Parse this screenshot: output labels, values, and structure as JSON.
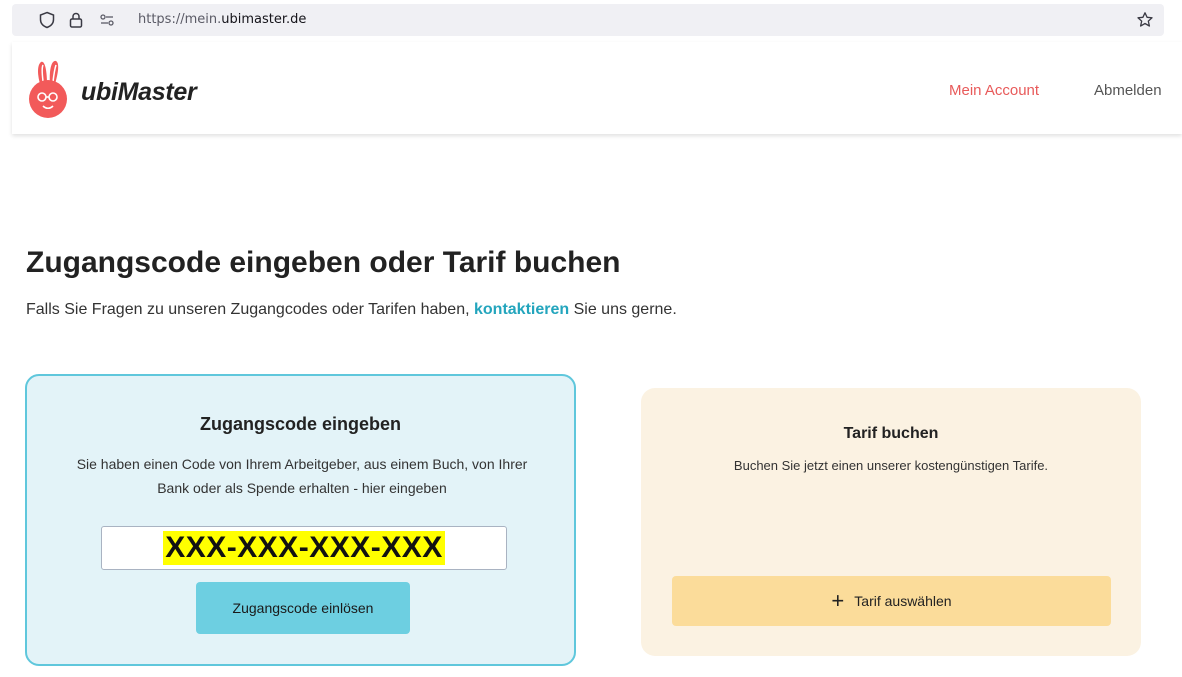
{
  "browser": {
    "url_prefix": "https://mein.",
    "url_domain": "ubimaster.de"
  },
  "header": {
    "brand": "ubiMaster",
    "nav": {
      "account": "Mein Account",
      "logout": "Abmelden"
    },
    "accent_color": "#e85a5a"
  },
  "main": {
    "title": "Zugangscode eingeben oder Tarif buchen",
    "subtitle_before": "Falls Sie Fragen zu unseren Zugangcodes oder Tarifen haben,",
    "subtitle_link": "kontaktieren",
    "subtitle_after": "Sie uns gerne."
  },
  "code_card": {
    "title": "Zugangscode eingeben",
    "description": "Sie haben einen Code von Ihrem Arbeitgeber, aus einem Buch, von Ihrer Bank oder als Spende erhalten - hier eingeben",
    "input_value": "XXX-XXX-XXX-XXX",
    "button": "Zugangscode einlösen"
  },
  "tarif_card": {
    "title": "Tarif buchen",
    "description": "Buchen Sie jetzt einen unserer kostengünstigen Tarife.",
    "button": "Tarif auswählen"
  },
  "icons": [
    "shield-icon",
    "lock-icon",
    "permissions-icon",
    "bookmark-star-icon",
    "logo-icon",
    "plus-icon"
  ]
}
